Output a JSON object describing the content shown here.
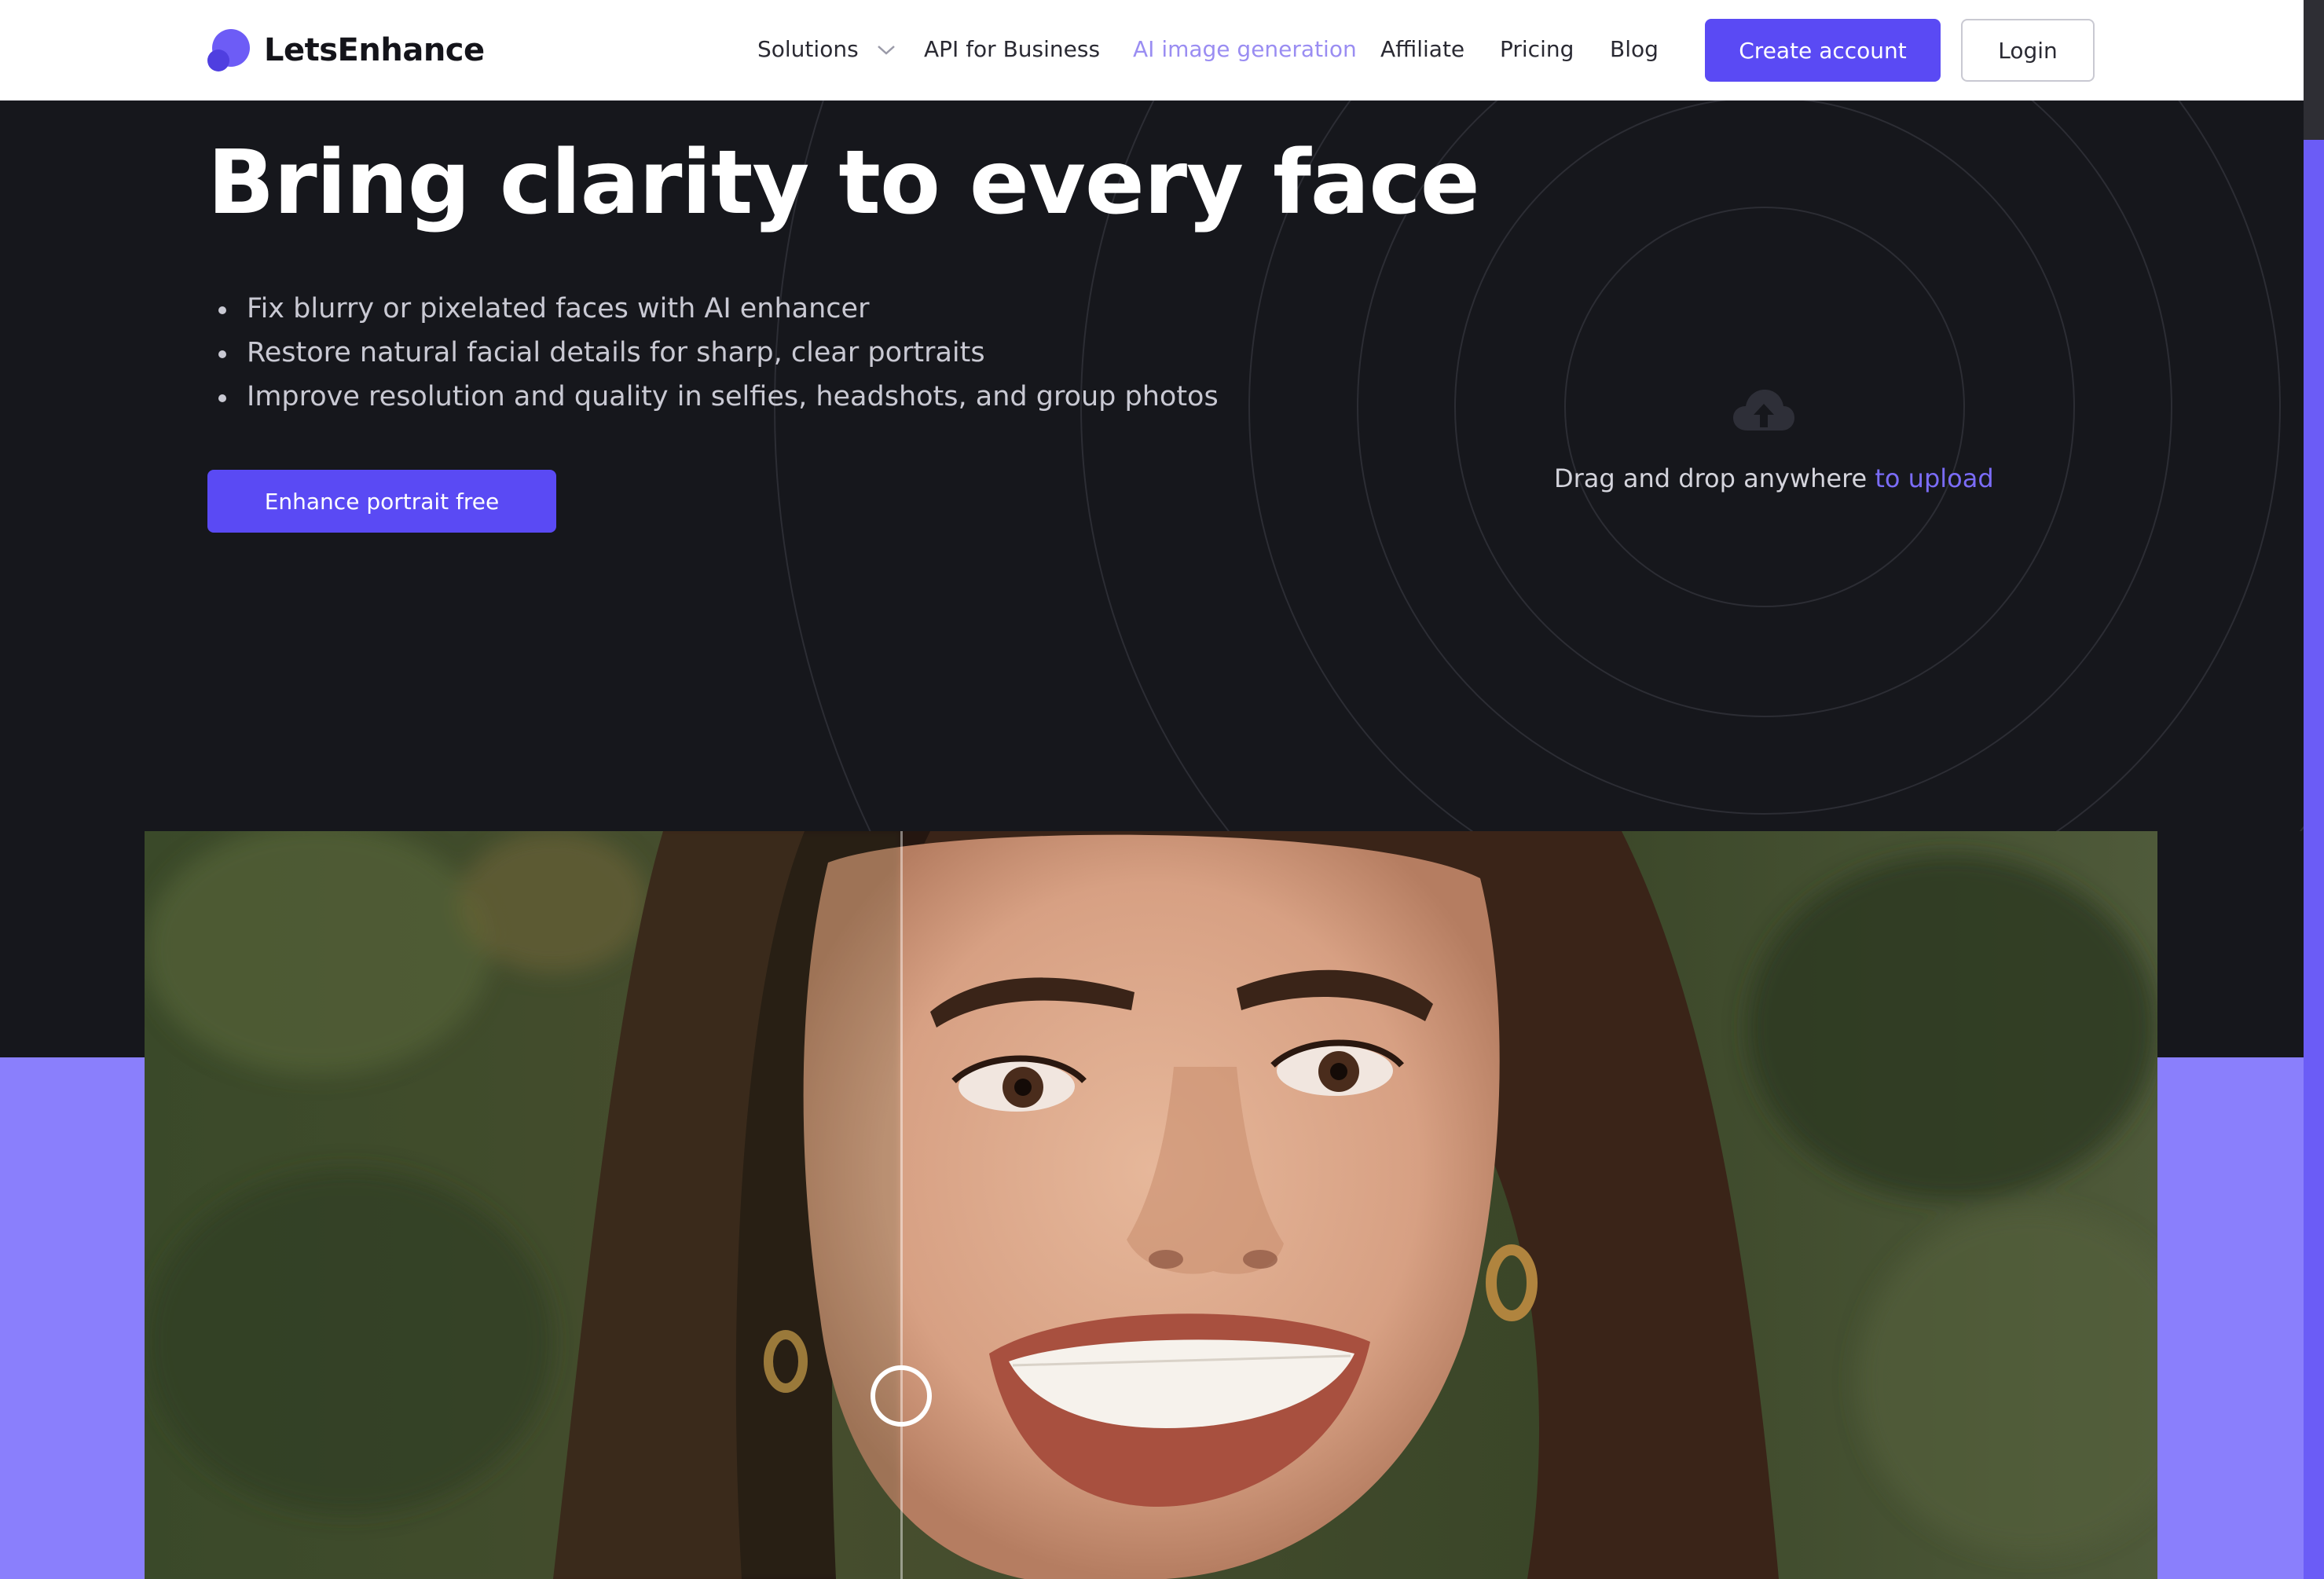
{
  "header": {
    "logo_text": "LetsEnhance",
    "nav": [
      {
        "label": "Solutions",
        "has_dropdown": true
      },
      {
        "label": "API for Business"
      },
      {
        "label": "AI image generation",
        "accent": true
      },
      {
        "label": "Affiliate"
      },
      {
        "label": "Pricing"
      },
      {
        "label": "Blog"
      }
    ],
    "create_account_label": "Create account",
    "login_label": "Login"
  },
  "hero": {
    "title": "Bring clarity to every face",
    "bullets": [
      "Fix blurry or pixelated faces with AI enhancer",
      "Restore natural facial details for sharp, clear portraits",
      "Improve resolution and quality in selfies, headshots, and group photos"
    ],
    "cta_label": "Enhance portrait free"
  },
  "upload": {
    "icon": "cloud-upload-icon",
    "text": "Drag and drop anywhere ",
    "link_text": "to upload"
  },
  "comparison": {
    "icon": "slider-handle-icon",
    "slider_position": 0.376
  },
  "colors": {
    "brand": "#5a4af4",
    "accent_link": "#7b6cf8",
    "hero_bg": "#16171c",
    "band": "#8a7ffc"
  }
}
